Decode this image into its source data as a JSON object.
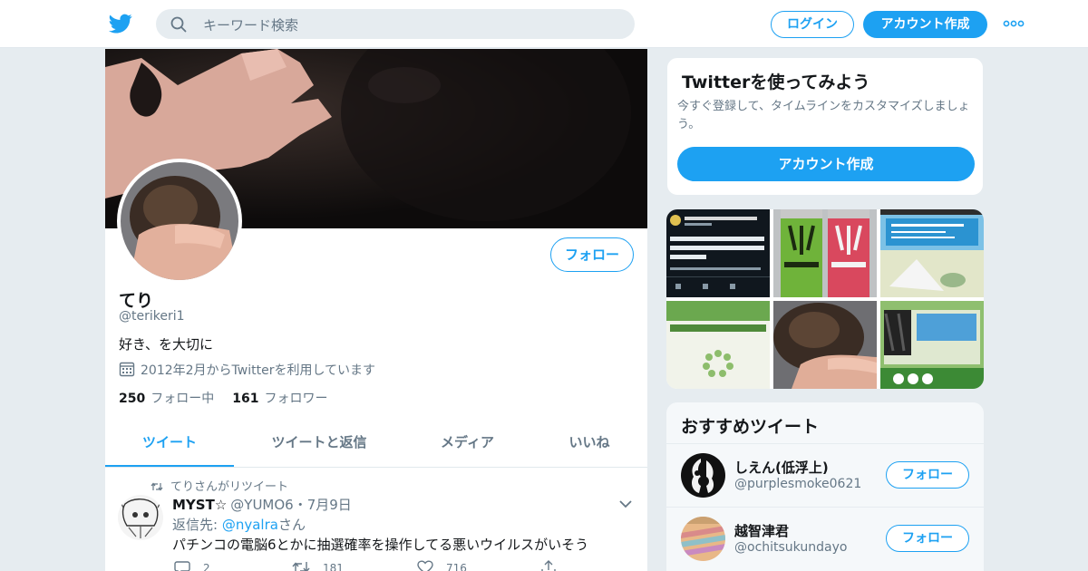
{
  "colors": {
    "accent": "#1da1f2",
    "background": "#e6ecf0",
    "text_secondary": "#657786"
  },
  "header": {
    "logo_icon": "twitter-bird-icon",
    "search_placeholder": "キーワード検索",
    "login_label": "ログイン",
    "signup_label": "アカウント作成",
    "more_icon": "more-dots-icon"
  },
  "profile": {
    "name": "てり",
    "handle": "@terikeri1",
    "bio": "好き、を大切に",
    "joined": "2012年2月からTwitterを利用しています",
    "following_count": "250",
    "following_label": "フォロー中",
    "followers_count": "161",
    "followers_label": "フォロワー",
    "follow_label": "フォロー"
  },
  "tabs": [
    {
      "label": "ツイート",
      "active": true
    },
    {
      "label": "ツイートと返信",
      "active": false
    },
    {
      "label": "メディア",
      "active": false
    },
    {
      "label": "いいね",
      "active": false
    }
  ],
  "tweet": {
    "retweet_context": "てりさんがリツイート",
    "author_name": "MYST☆",
    "author_handle": "@YUMO6",
    "date": "・7月9日",
    "reply_prefix": "返信先: ",
    "reply_mention": "@nyalra",
    "reply_suffix": "さん",
    "text": "パチンコの電脳6とかに抽選確率を操作してる悪いウイルスがいそう",
    "replies": "2",
    "retweets": "181",
    "likes": "716"
  },
  "sidebar": {
    "signup_card": {
      "title": "Twitterを使ってみよう",
      "description": "今すぐ登録して、タイムラインをカスタマイズしましょう。",
      "button_label": "アカウント作成"
    },
    "media_tiles": [
      "media-thumbnail-tweet-screenshot",
      "media-thumbnail-energy-cans",
      "media-thumbnail-game-screen",
      "media-thumbnail-loading-screen",
      "media-thumbnail-cat-in-hand",
      "media-thumbnail-game-stage"
    ],
    "recommended": {
      "title": "おすすめツイート",
      "accounts": [
        {
          "name": "しえん(低浮上)",
          "handle": "@purplesmoke0621",
          "follow_label": "フォロー"
        },
        {
          "name": "越智津君",
          "handle": "@ochitsukundayo",
          "follow_label": "フォロー"
        }
      ]
    }
  }
}
